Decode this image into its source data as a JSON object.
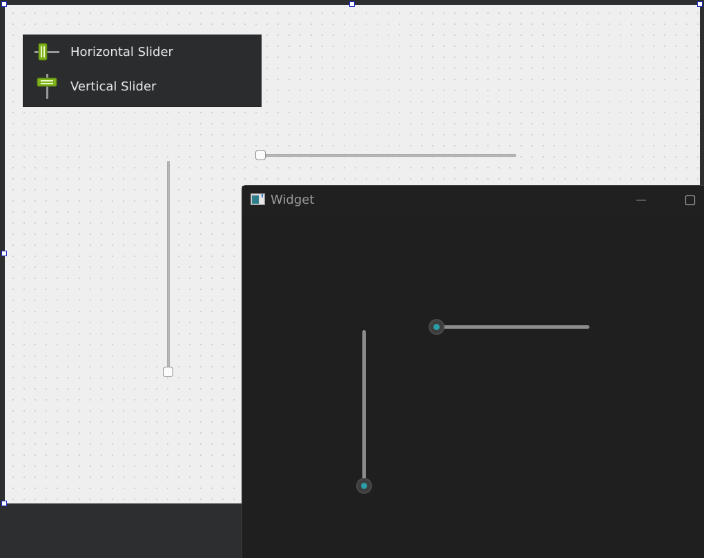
{
  "palette": {
    "items": [
      {
        "label": "Horizontal Slider",
        "icon": "horizontal-slider-icon"
      },
      {
        "label": "Vertical Slider",
        "icon": "vertical-slider-icon"
      }
    ]
  },
  "designer": {
    "horizontal_slider": {
      "value_fraction": 0.0
    },
    "vertical_slider": {
      "value_fraction": 0.0
    }
  },
  "preview_window": {
    "title": "Widget",
    "icon": "qt-app-icon",
    "minimize_glyph": "—",
    "maximize_glyph": "☐",
    "horizontal_slider": {
      "value_fraction": 0.0
    },
    "vertical_slider": {
      "value_fraction": 0.0
    }
  },
  "colors": {
    "accent": "#2a9ea8",
    "selection_handle": "#1a28c8",
    "preview_background": "#1f1f1f"
  }
}
